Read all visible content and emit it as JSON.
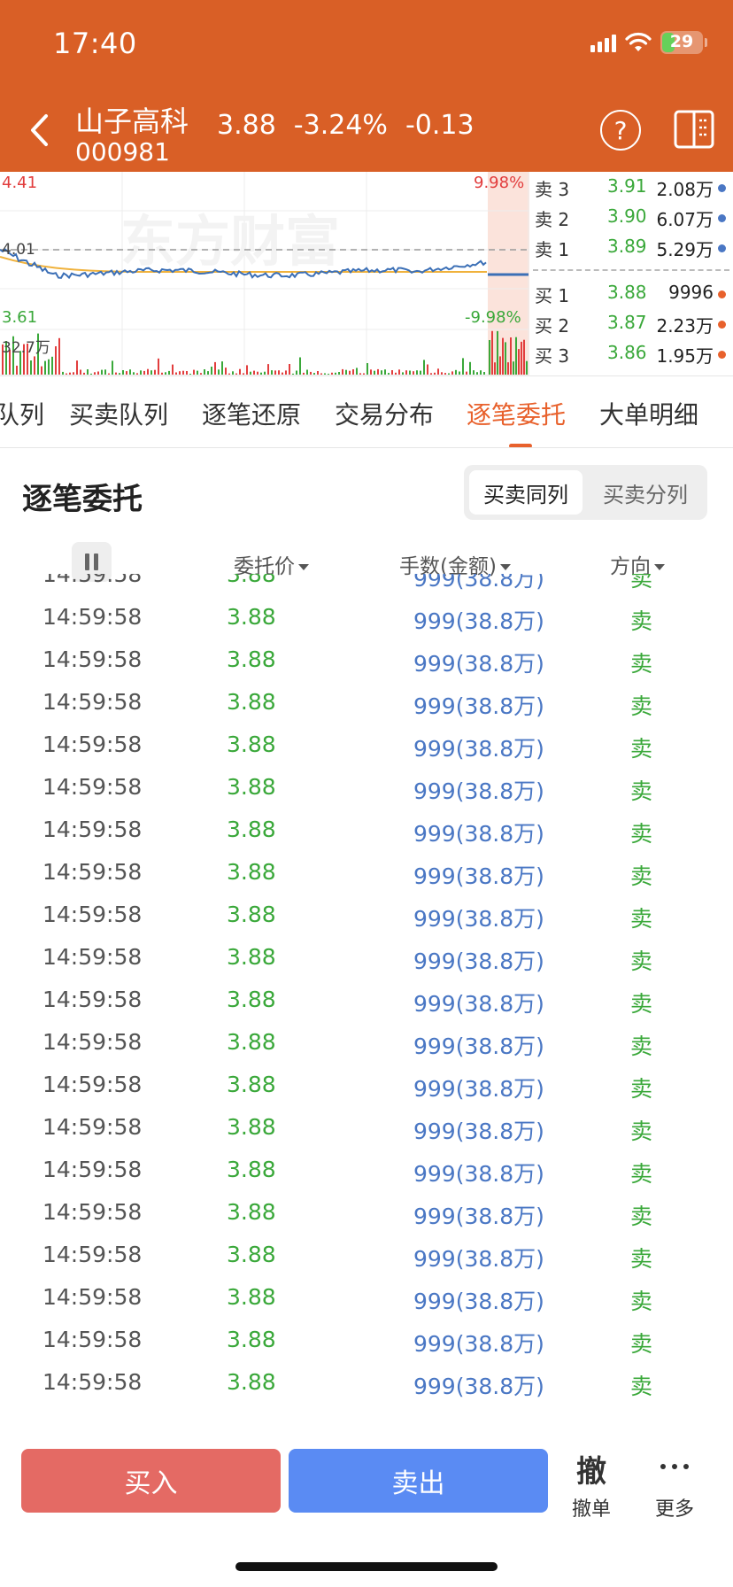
{
  "status_bar": {
    "time": "17:40",
    "battery": "29"
  },
  "header": {
    "stock_name": "山子高科",
    "stock_code": "000981",
    "price": "3.88",
    "change_pct": "-3.24%",
    "change": "-0.13"
  },
  "chart": {
    "high": "4.41",
    "prev_close": "4.01",
    "low": "3.61",
    "limit_up_pct": "9.98%",
    "limit_down_pct": "-9.98%",
    "volume_max": "32.7万",
    "watermark": "东方财富",
    "colors": {
      "price_line": "#3b6fb6",
      "avg_line": "#f0b23c",
      "up": "#e23d3d",
      "down": "#3aa83a"
    }
  },
  "orderbook": {
    "asks": [
      {
        "label": "卖 3",
        "price": "3.91",
        "volume": "2.08万"
      },
      {
        "label": "卖 2",
        "price": "3.90",
        "volume": "6.07万"
      },
      {
        "label": "卖 1",
        "price": "3.89",
        "volume": "5.29万"
      }
    ],
    "bids": [
      {
        "label": "买 1",
        "price": "3.88",
        "volume": "9996"
      },
      {
        "label": "买 2",
        "price": "3.87",
        "volume": "2.23万"
      },
      {
        "label": "买 3",
        "price": "3.86",
        "volume": "1.95万"
      }
    ]
  },
  "tabs": [
    "队列",
    "买卖队列",
    "逐笔还原",
    "交易分布",
    "逐笔委托",
    "大单明细"
  ],
  "active_tab": "逐笔委托",
  "section": {
    "title": "逐笔委托",
    "toggle": [
      "买卖同列",
      "买卖分列"
    ],
    "columns": {
      "price": "委托价",
      "volume": "手数(金额)",
      "direction": "方向"
    }
  },
  "rows": [
    {
      "time": "14:59:58",
      "price": "3.88",
      "volume": "999(38.8万)",
      "direction": "卖"
    },
    {
      "time": "14:59:58",
      "price": "3.88",
      "volume": "999(38.8万)",
      "direction": "卖"
    },
    {
      "time": "14:59:58",
      "price": "3.88",
      "volume": "999(38.8万)",
      "direction": "卖"
    },
    {
      "time": "14:59:58",
      "price": "3.88",
      "volume": "999(38.8万)",
      "direction": "卖"
    },
    {
      "time": "14:59:58",
      "price": "3.88",
      "volume": "999(38.8万)",
      "direction": "卖"
    },
    {
      "time": "14:59:58",
      "price": "3.88",
      "volume": "999(38.8万)",
      "direction": "卖"
    },
    {
      "time": "14:59:58",
      "price": "3.88",
      "volume": "999(38.8万)",
      "direction": "卖"
    },
    {
      "time": "14:59:58",
      "price": "3.88",
      "volume": "999(38.8万)",
      "direction": "卖"
    },
    {
      "time": "14:59:58",
      "price": "3.88",
      "volume": "999(38.8万)",
      "direction": "卖"
    },
    {
      "time": "14:59:58",
      "price": "3.88",
      "volume": "999(38.8万)",
      "direction": "卖"
    },
    {
      "time": "14:59:58",
      "price": "3.88",
      "volume": "999(38.8万)",
      "direction": "卖"
    },
    {
      "time": "14:59:58",
      "price": "3.88",
      "volume": "999(38.8万)",
      "direction": "卖"
    },
    {
      "time": "14:59:58",
      "price": "3.88",
      "volume": "999(38.8万)",
      "direction": "卖"
    },
    {
      "time": "14:59:58",
      "price": "3.88",
      "volume": "999(38.8万)",
      "direction": "卖"
    },
    {
      "time": "14:59:58",
      "price": "3.88",
      "volume": "999(38.8万)",
      "direction": "卖"
    },
    {
      "time": "14:59:58",
      "price": "3.88",
      "volume": "999(38.8万)",
      "direction": "卖"
    },
    {
      "time": "14:59:58",
      "price": "3.88",
      "volume": "999(38.8万)",
      "direction": "卖"
    },
    {
      "time": "14:59:58",
      "price": "3.88",
      "volume": "999(38.8万)",
      "direction": "卖"
    },
    {
      "time": "14:59:58",
      "price": "3.88",
      "volume": "999(38.8万)",
      "direction": "卖"
    },
    {
      "time": "14:59:58",
      "price": "3.88",
      "volume": "999(38.8万)",
      "direction": "卖"
    }
  ],
  "bottom": {
    "buy": "买入",
    "sell": "卖出",
    "cancel_glyph": "撤",
    "cancel": "撤单",
    "more": "更多"
  }
}
